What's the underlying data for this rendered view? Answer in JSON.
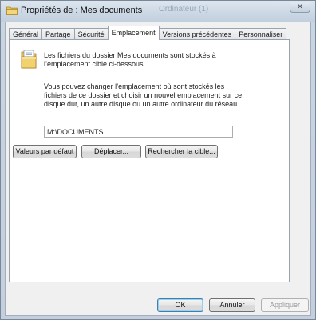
{
  "window": {
    "title": "Propriétés de : Mes documents",
    "background_title": "Ordinateur (1)",
    "close_label": "✕"
  },
  "tabs": [
    {
      "label": "Général"
    },
    {
      "label": "Partage"
    },
    {
      "label": "Sécurité"
    },
    {
      "label": "Emplacement",
      "active": true
    },
    {
      "label": "Versions précédentes"
    },
    {
      "label": "Personnaliser"
    }
  ],
  "location": {
    "info": "Les fichiers du dossier Mes documents sont stockés à l’emplacement cible ci-dessous.",
    "description": "Vous pouvez changer l’emplacement où sont stockés les fichiers de ce dossier et choisir un nouvel emplacement sur ce disque dur, un autre disque ou un autre ordinateur du réseau.",
    "path_value": "M:\\DOCUMENTS",
    "restore_default_label": "Valeurs par défaut",
    "move_label": "Déplacer...",
    "find_target_label": "Rechercher la cible..."
  },
  "footer": {
    "ok_label": "OK",
    "cancel_label": "Annuler",
    "apply_label": "Appliquer"
  },
  "icons": {
    "title": "folder-icon",
    "location": "documents-folder-icon",
    "close": "close-icon"
  },
  "colors": {
    "title_bar": "#cbd7e4",
    "dialog_bg": "#f0f0f0",
    "panel_bg": "#ffffff",
    "folder": "#e9c560"
  }
}
